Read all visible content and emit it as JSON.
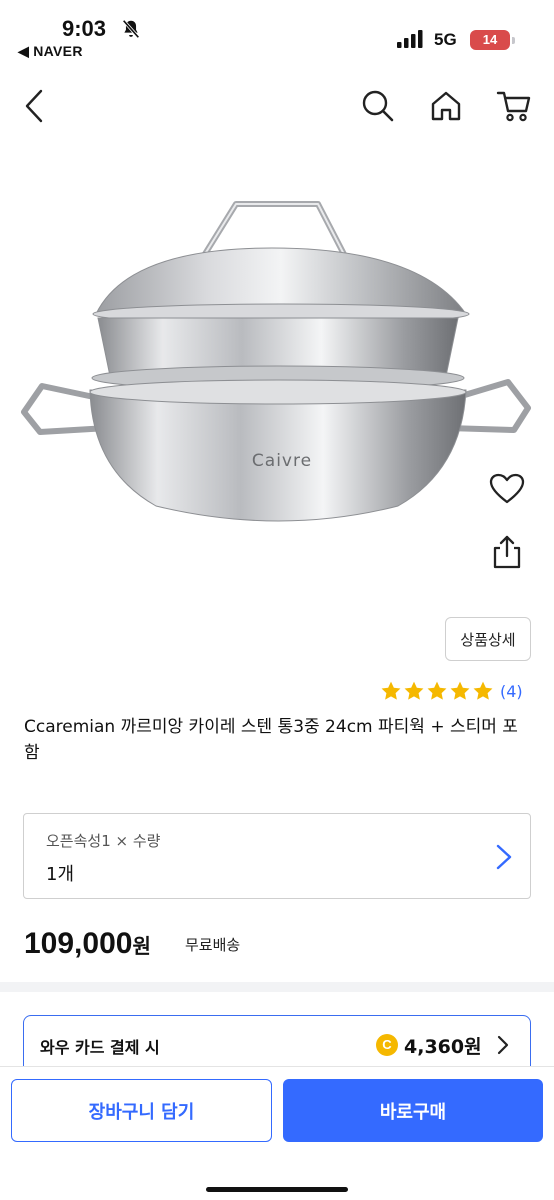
{
  "status_bar": {
    "time": "9:03",
    "back_app": "◀ NAVER",
    "network": "5G",
    "battery": "14"
  },
  "nav": {
    "icons": [
      "back-icon",
      "search-icon",
      "home-icon",
      "cart-icon"
    ]
  },
  "product": {
    "brand_on_image": "Caivre",
    "detail_button": "상품상세",
    "rating_stars": 5,
    "rating_count": "(4)",
    "title": "Ccaremian 까르미앙 카이레 스텐 통3중 24cm 파티웍 + 스티머 포함",
    "side_icons": [
      "heart-icon",
      "share-icon"
    ]
  },
  "option": {
    "label": "오픈속성1 × 수량",
    "value": "1개"
  },
  "price": {
    "amount": "109,000",
    "unit": "원",
    "shipping": "무료배송"
  },
  "card_offer": {
    "label": "와우 카드 결제 시",
    "coin_symbol": "C",
    "amount": "4,360원"
  },
  "bottom": {
    "cart_button": "장바구니 담기",
    "buy_button": "바로구매"
  },
  "colors": {
    "accent": "#346aff",
    "star": "#f5b800",
    "battery": "#d94b4b"
  }
}
